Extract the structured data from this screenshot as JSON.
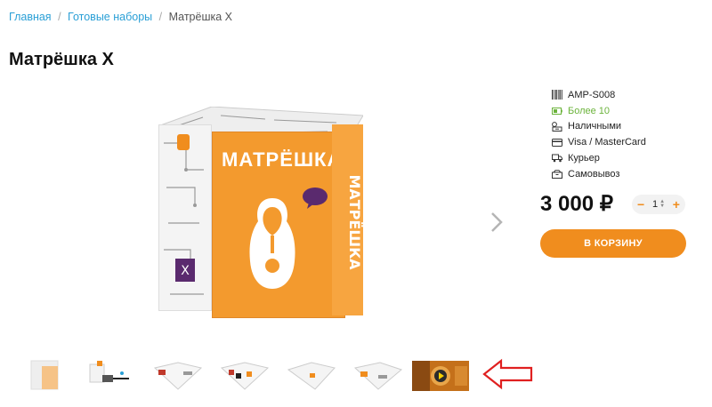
{
  "breadcrumb": {
    "home": "Главная",
    "section": "Готовые наборы",
    "current": "Матрёшка X",
    "separator": "/"
  },
  "product": {
    "title": "Матрёшка X",
    "box_brand": "МАТРЁШКА",
    "box_side_text": "МАТРЁШКА",
    "info": [
      {
        "icon": "barcode-icon",
        "text": "AMP-S008"
      },
      {
        "icon": "battery-icon",
        "text": "Более 10"
      },
      {
        "icon": "cash-icon",
        "text": "Наличными"
      },
      {
        "icon": "card-icon",
        "text": "Visa / MasterCard"
      },
      {
        "icon": "truck-icon",
        "text": "Курьер"
      },
      {
        "icon": "box-icon",
        "text": "Самовывоз"
      }
    ],
    "price": "3 000 ₽",
    "quantity": "1",
    "qty_minus": "−",
    "qty_plus": "+",
    "cart_label": "В КОРЗИНУ"
  },
  "colors": {
    "accent": "#f08d1e",
    "link": "#2a9fd6",
    "stock": "#6bb33b",
    "annotation_arrow": "#e02020"
  },
  "icons": {
    "next": "chevron-right-icon",
    "annotation": "arrow-left-icon"
  }
}
